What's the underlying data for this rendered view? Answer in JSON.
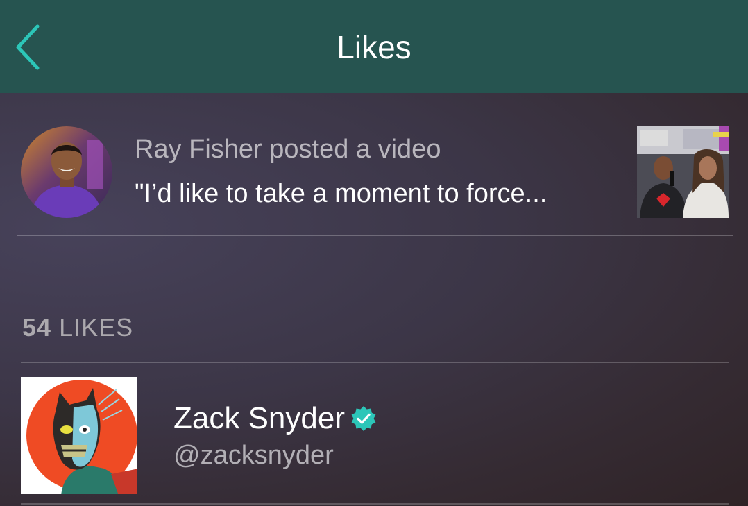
{
  "header": {
    "title": "Likes",
    "back_icon": "chevron-left-icon",
    "accent_color": "#2cc6b8",
    "background_color": "#265450"
  },
  "post": {
    "title": "Ray Fisher posted a video",
    "caption": "\"I’d like to take a moment to force...",
    "avatar_icon": "user-avatar",
    "thumbnail_icon": "video-thumbnail"
  },
  "likes": {
    "count": "54",
    "label": "LIKES"
  },
  "users": [
    {
      "name": "Zack Snyder",
      "handle": "@zacksnyder",
      "verified": true,
      "verified_icon": "verified-check-icon",
      "verified_color": "#2cc6b8"
    }
  ]
}
